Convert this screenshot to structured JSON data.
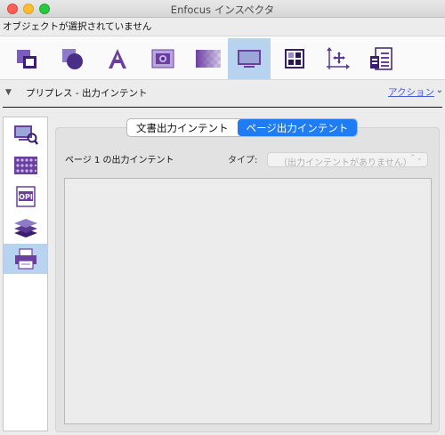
{
  "window": {
    "title": "Enfocus インスペクタ"
  },
  "status": {
    "text": "オブジェクトが選択されていません"
  },
  "toolbar": {
    "tools": [
      {
        "name": "object-tool",
        "icon": "object-square-icon",
        "active": false
      },
      {
        "name": "fill-stroke-tool",
        "icon": "color-shapes-icon",
        "active": false
      },
      {
        "name": "text-tool",
        "icon": "text-a-icon",
        "active": false
      },
      {
        "name": "image-tool",
        "icon": "camera-icon",
        "active": false
      },
      {
        "name": "transparency-tool",
        "icon": "transparency-checker-icon",
        "active": false
      },
      {
        "name": "prepress-tool",
        "icon": "monitor-icon",
        "active": true
      },
      {
        "name": "color-tool",
        "icon": "color-grid-icon",
        "active": false
      },
      {
        "name": "position-tool",
        "icon": "move-axes-icon",
        "active": false
      },
      {
        "name": "document-tool",
        "icon": "document-list-icon",
        "active": false
      }
    ]
  },
  "section": {
    "title": "プリプレス - 出力インテント",
    "action_label": "アクション"
  },
  "sidebar": {
    "items": [
      {
        "name": "preview",
        "icon": "monitor-magnify-icon",
        "active": false
      },
      {
        "name": "halftone",
        "icon": "halftone-dots-icon",
        "active": false
      },
      {
        "name": "opi",
        "icon": "opi-icon",
        "label": "OPI",
        "active": false
      },
      {
        "name": "layers",
        "icon": "layers-stack-icon",
        "active": false
      },
      {
        "name": "output",
        "icon": "printer-icon",
        "active": true
      }
    ]
  },
  "tabs": {
    "document": "文書出力インテント",
    "page": "ページ出力インテント",
    "selected": "page"
  },
  "content": {
    "intent_label": "ページ 1 の出力インテント",
    "type_label": "タイプ:",
    "type_value": "（出力インテントがありません）",
    "arrow": "⌃⌄"
  },
  "colors": {
    "selection": "#b7d3ef",
    "accent": "#1e7cf5",
    "purple": "#6b3fa0"
  }
}
